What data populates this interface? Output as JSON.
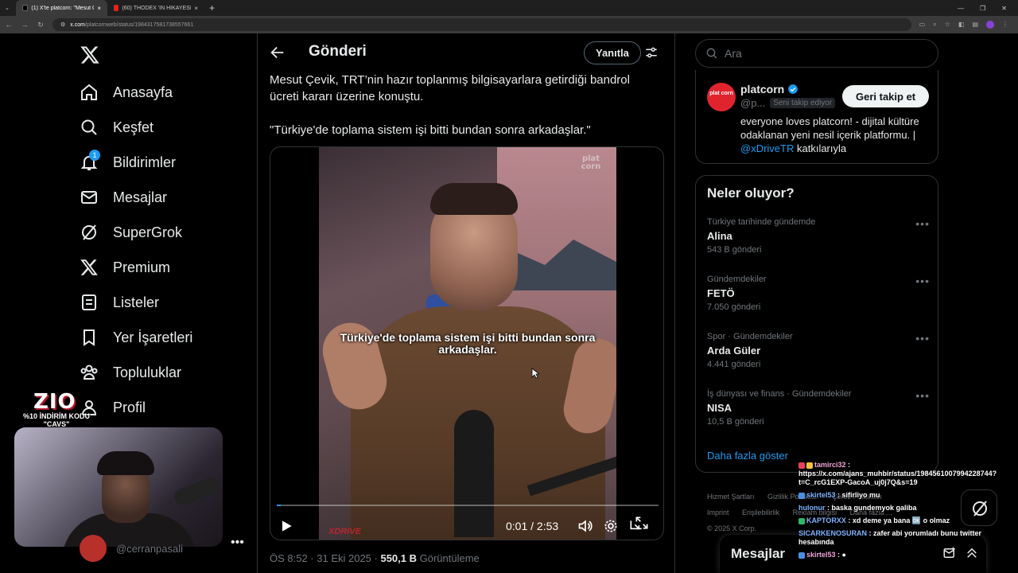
{
  "browser": {
    "tabs": [
      {
        "label": "(1) X'te platcorn: \"Mesut Ç...",
        "active": true
      },
      {
        "label": "(60) THODEX 'İN HİKAYESİ - FA...",
        "active": false
      }
    ],
    "url_host": "x.com",
    "url_path": "/platcornweb/status/1984317581738557661"
  },
  "nav": {
    "items": [
      {
        "label": "Anasayfa",
        "icon": "home-icon"
      },
      {
        "label": "Keşfet",
        "icon": "search-icon"
      },
      {
        "label": "Bildirimler",
        "icon": "bell-icon"
      },
      {
        "label": "Mesajlar",
        "icon": "mail-icon"
      },
      {
        "label": "SuperGrok",
        "icon": "grok-icon"
      },
      {
        "label": "Premium",
        "icon": "x-icon"
      },
      {
        "label": "Listeler",
        "icon": "list-icon"
      },
      {
        "label": "Yer İşaretleri",
        "icon": "bookmark-icon"
      },
      {
        "label": "Topluluklar",
        "icon": "communities-icon"
      },
      {
        "label": "Profil",
        "icon": "profile-icon"
      }
    ],
    "notification_count": "1",
    "profile_handle": "@cerranpasali"
  },
  "overlay": {
    "logo_text": "ZIO",
    "promo_line1": "%10 İNDİRİM KODU",
    "promo_line2": "\"CAVS\""
  },
  "post": {
    "header_title": "Gönderi",
    "reply_label": "Yanıtla",
    "text_p1": "Mesut Çevik, TRT’nin hazır toplanmış bilgisayarlara getirdiği bandrol ücreti kararı üzerine konuştu.",
    "text_p2": "\"Türkiye'de toplama sistem işi bitti bundan sonra arkadaşlar.\"",
    "video_caption": "Türkiye'de toplama sistem işi bitti bundan sonra arkadaşlar.",
    "video_logo": "plat corn",
    "video_brand": "XDRIVE",
    "video_time": "0:01 / 2:53",
    "video_progress": 0.01,
    "meta_time": "ÖS 8:52 · 31 Eki 2025 · ",
    "meta_views": "550,1 B",
    "meta_views_label": " Görüntüleme"
  },
  "search": {
    "placeholder": "Ara"
  },
  "profile_card": {
    "name": "platcorn",
    "handle": "@p...",
    "follows_you": "Seni takip ediyor",
    "followback_label": "Geri takip et",
    "bio_prefix": "everyone loves platcorn! - dijital kültüre odaklanan yeni nesil içerik platformu. | ",
    "bio_mention": "@xDriveTR",
    "bio_suffix": " katkılarıyla",
    "avatar_text": "plat corn"
  },
  "trends": {
    "title": "Neler oluyor?",
    "items": [
      {
        "context": "Türkiye tarihinde gündemde",
        "name": "Alina",
        "count": "543 B gönderi"
      },
      {
        "context": "Gündemdekiler",
        "name": "FETÖ",
        "count": "7.050 gönderi"
      },
      {
        "context": "Spor · Gündemdekiler",
        "name": "Arda Güler",
        "count": "4.441 gönderi"
      },
      {
        "context": "İş dünyası ve finans · Gündemdekiler",
        "name": "NISA",
        "count": "10,5 B gönderi"
      }
    ],
    "show_more": "Daha fazla göster"
  },
  "footer": {
    "links": [
      "Hizmet Şartları",
      "Gizlilik Politikası",
      "Çerez Politikası",
      "Imprint",
      "Erişilebilirlik",
      "Reklam bilgisi",
      "Daha fazla ..."
    ],
    "copyright": "© 2025 X Corp."
  },
  "messages": {
    "title": "Mesajlar"
  },
  "chat": [
    {
      "user": "tamirci32",
      "text": " : https://x.com/ajans_muhbir/status/1984561007994228744?t=C_rcG1EXP-GacoA_uj0j7Q&s=19"
    },
    {
      "user": "skirtel53",
      "text": " : sifirliyo mu"
    },
    {
      "user": "hulonur",
      "text": " : baska gundemyok galiba"
    },
    {
      "user": "KAPTORXX",
      "text": " : xd deme ya bana 🆗 o olmaz"
    },
    {
      "user": "SICARKENOSURAN",
      "text": " : zafer abi yorumladı bunu twitter hesabında"
    },
    {
      "user": "skirtel53",
      "text": " : ●"
    }
  ],
  "colors": {
    "accent": "#1d9bf0",
    "brand_red": "#e0242d",
    "background": "#000000"
  }
}
